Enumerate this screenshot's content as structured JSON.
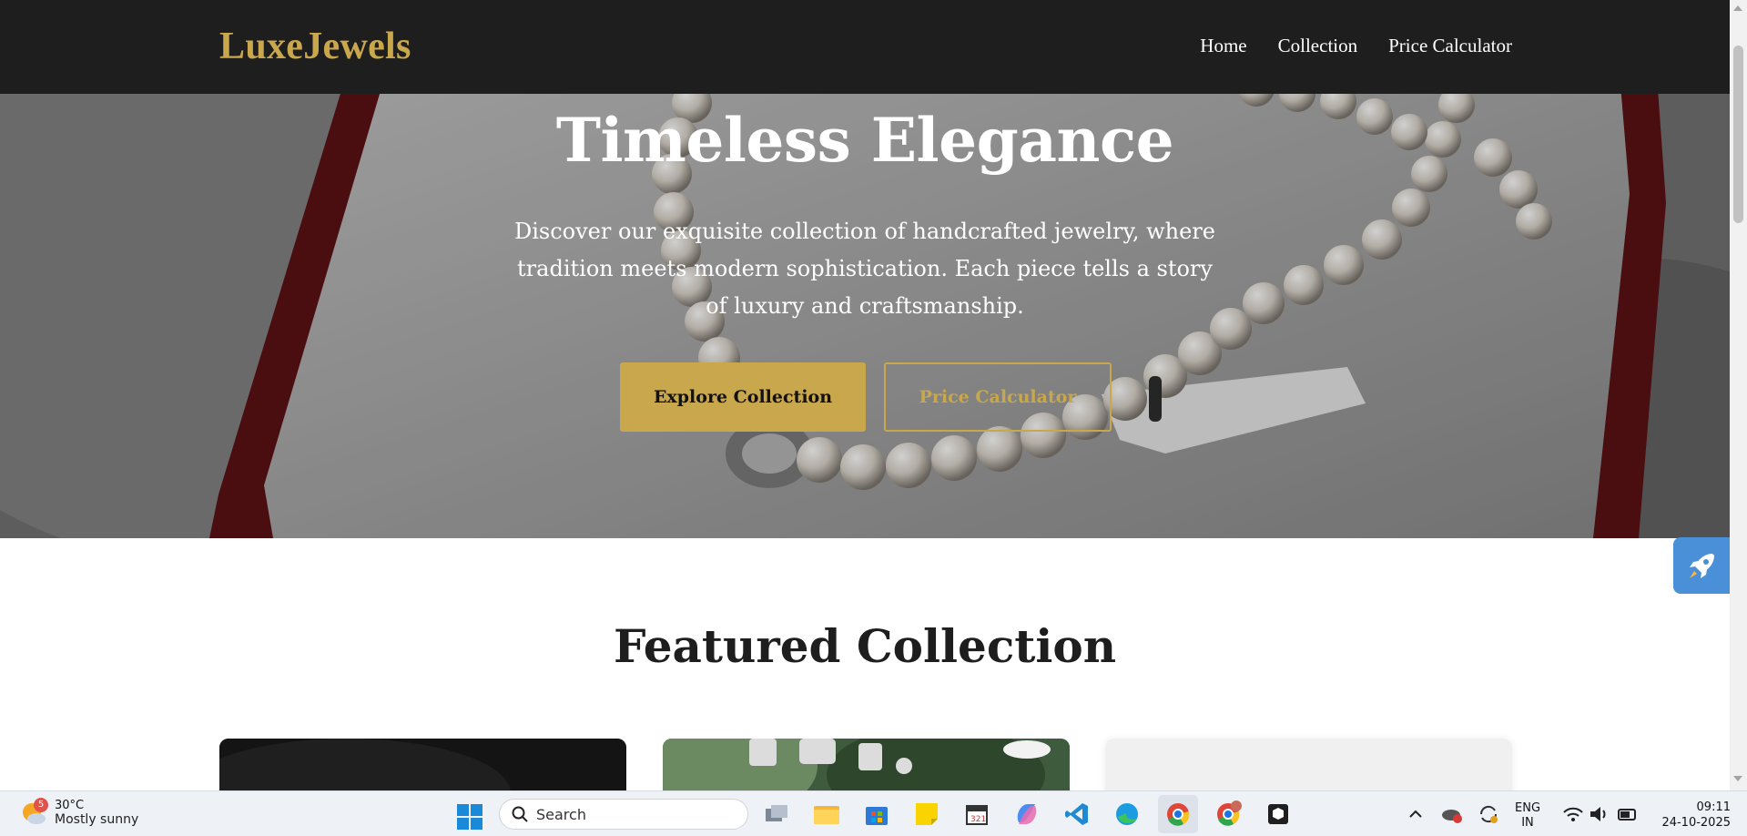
{
  "nav": {
    "logo": "LuxeJewels",
    "links": [
      "Home",
      "Collection",
      "Price Calculator"
    ]
  },
  "hero": {
    "title": "Timeless Elegance",
    "description": "Discover our exquisite collection of handcrafted jewelry, where tradition meets modern sophistication. Each piece tells a story of luxury and craftsmanship.",
    "primary_button": "Explore Collection",
    "secondary_button": "Price Calculator"
  },
  "featured": {
    "title": "Featured Collection"
  },
  "taskbar": {
    "weather_badge": "5",
    "temperature": "30°C",
    "condition": "Mostly sunny",
    "search_label": "Search",
    "language_line1": "ENG",
    "language_line2": "IN",
    "time": "09:11",
    "date": "24-10-2025"
  },
  "colors": {
    "accent_gold": "#c9a74c",
    "nav_background": "#1e1e1e",
    "rocket_button": "#4a90d9"
  }
}
